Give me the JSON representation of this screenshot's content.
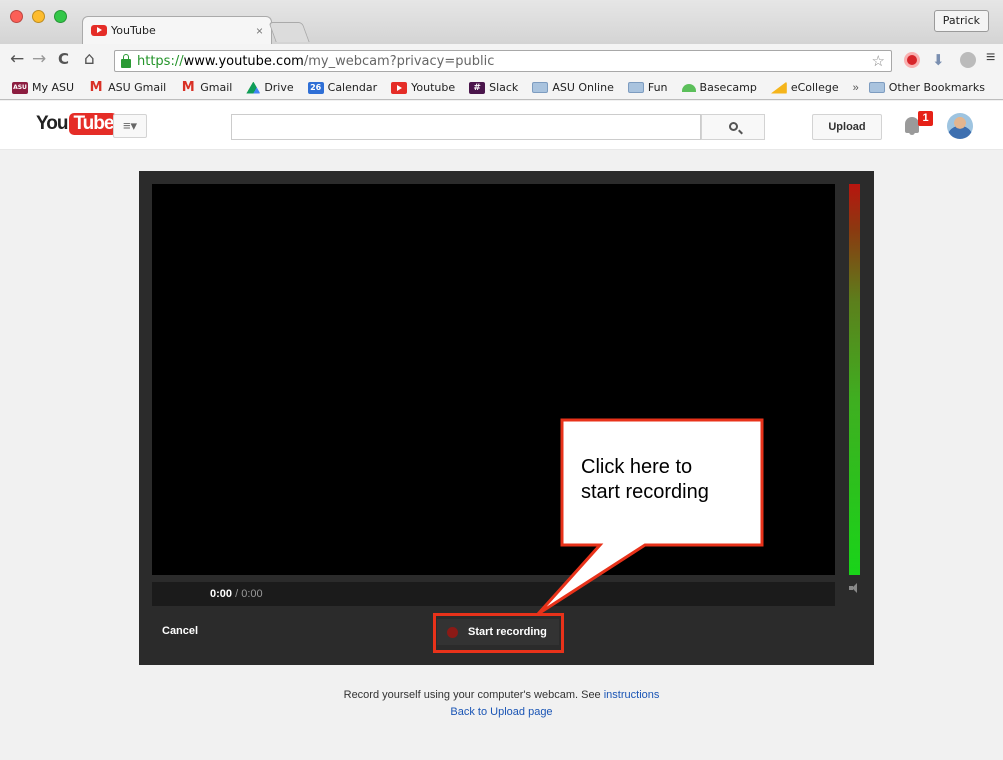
{
  "browser": {
    "tab_title": "YouTube",
    "tab_close": "×",
    "profile_name": "Patrick",
    "nav": {
      "back": "←",
      "forward": "→",
      "reload": "C",
      "home": "⌂",
      "menu": "≡"
    },
    "url": {
      "scheme": "https://",
      "host": "www.youtube.com",
      "path": "/my_webcam?privacy=public"
    },
    "star": "☆",
    "ext_download": "⬇",
    "bookmarks": [
      {
        "label": "My ASU",
        "icon": "asu-icon",
        "glyph": "ASU"
      },
      {
        "label": "ASU Gmail",
        "icon": "gmail-icon",
        "glyph": "M"
      },
      {
        "label": "Gmail",
        "icon": "gmail-icon",
        "glyph": "M"
      },
      {
        "label": "Drive",
        "icon": "drive-icon",
        "glyph": ""
      },
      {
        "label": "Calendar",
        "icon": "calendar-icon",
        "glyph": "26"
      },
      {
        "label": "Youtube",
        "icon": "youtube-icon",
        "glyph": ""
      },
      {
        "label": "Slack",
        "icon": "slack-icon",
        "glyph": "#"
      },
      {
        "label": "ASU Online",
        "icon": "folder-icon",
        "glyph": ""
      },
      {
        "label": "Fun",
        "icon": "folder-icon",
        "glyph": ""
      },
      {
        "label": "Basecamp",
        "icon": "basecamp-icon",
        "glyph": ""
      },
      {
        "label": "eCollege",
        "icon": "ecollege-icon",
        "glyph": ""
      }
    ],
    "bookmarks_more": "»",
    "other_bookmarks": "Other Bookmarks"
  },
  "youtube": {
    "logo_you": "You",
    "logo_tube": "Tube",
    "guide_label": "≡▾",
    "search_placeholder": "",
    "upload_label": "Upload",
    "notification_count": "1"
  },
  "recorder": {
    "time_current": "0:00",
    "time_separator": " / ",
    "time_total": "0:00",
    "cancel_label": "Cancel",
    "start_label": "Start recording"
  },
  "callout": {
    "line1": "Click here to",
    "line2": "start recording"
  },
  "footer": {
    "text": "Record yourself using your computer's webcam. See ",
    "instructions_link": "instructions",
    "back_link": "Back to Upload page"
  },
  "colors": {
    "youtube_red": "#e52d27",
    "annotation_red": "#e8321a",
    "link_blue": "#1a55b5",
    "secure_green": "#24942a"
  }
}
